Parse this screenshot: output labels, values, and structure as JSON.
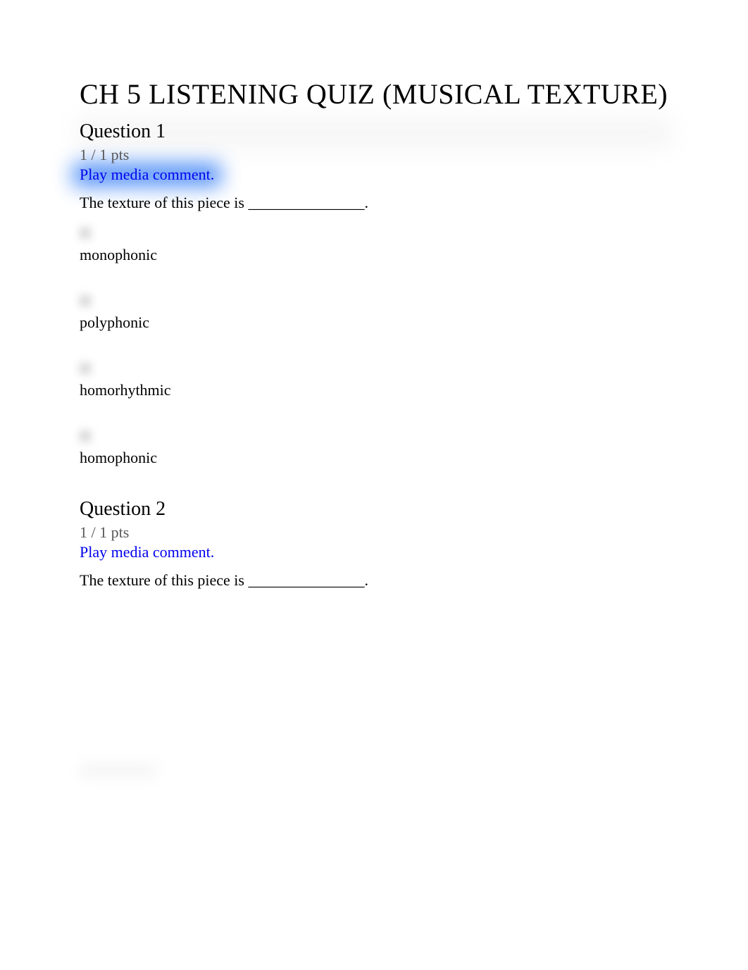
{
  "title": "CH 5 LISTENING QUIZ (MUSICAL TEXTURE)",
  "questions": [
    {
      "heading": "Question 1",
      "points": "1 / 1 pts",
      "media_link": "Play media comment.",
      "prompt": "The texture of this piece is _______________.",
      "highlighted": true,
      "options": [
        {
          "text": "monophonic"
        },
        {
          "text": "polyphonic"
        },
        {
          "text": "homorhythmic"
        },
        {
          "text": "homophonic"
        }
      ]
    },
    {
      "heading": "Question 2",
      "points": "1 / 1 pts",
      "media_link": "Play media comment.",
      "prompt": "The texture of this piece is _______________.",
      "highlighted": false,
      "options": []
    }
  ]
}
